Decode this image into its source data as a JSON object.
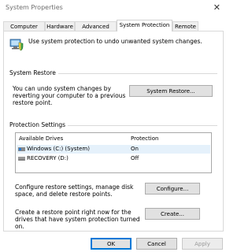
{
  "window": {
    "title": "System Properties",
    "close_glyph": "✕"
  },
  "tabs": [
    {
      "label": "Computer Name"
    },
    {
      "label": "Hardware"
    },
    {
      "label": "Advanced"
    },
    {
      "label": "System Protection"
    },
    {
      "label": "Remote"
    }
  ],
  "intro": {
    "text": "Use system protection to undo unwanted system changes.",
    "icon": "shield-computer-icon"
  },
  "system_restore": {
    "heading": "System Restore",
    "description": "You can undo system changes by reverting your computer to a previous restore point.",
    "button": "System Restore..."
  },
  "protection": {
    "heading": "Protection Settings",
    "columns": [
      "Available Drives",
      "Protection"
    ],
    "drives": [
      {
        "name": "Windows (C:) (System)",
        "protection": "On",
        "icon": "system-drive-icon"
      },
      {
        "name": "RECOVERY (D:)",
        "protection": "Off",
        "icon": "drive-icon"
      }
    ],
    "configure_text": "Configure restore settings, manage disk space, and delete restore points.",
    "configure_button": "Configure...",
    "create_text": "Create a restore point right now for the drives that have system protection turned on.",
    "create_button": "Create..."
  },
  "footer": {
    "ok": "OK",
    "cancel": "Cancel",
    "apply": "Apply"
  },
  "colors": {
    "accent": "#0078d7",
    "selected_row": "#e5f1fb",
    "button_face": "#e1e1e1"
  }
}
